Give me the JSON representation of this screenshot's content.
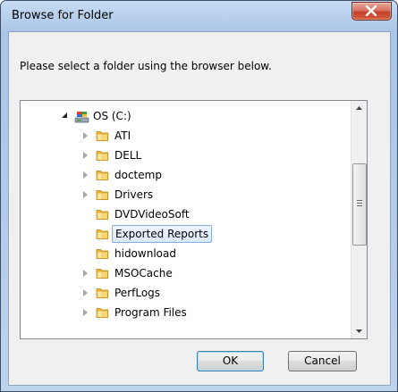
{
  "window": {
    "title": "Browse for Folder",
    "close_label": "X"
  },
  "dialog": {
    "prompt": "Please select a folder using the browser below.",
    "ok_label": "OK",
    "cancel_label": "Cancel"
  },
  "tree": {
    "items": [
      {
        "label": "OS (C:)",
        "expander": "expanded",
        "icon": "drive-icon",
        "level": 0
      },
      {
        "label": "ATI",
        "expander": "collapsed",
        "icon": "folder-icon",
        "level": 1
      },
      {
        "label": "DELL",
        "expander": "collapsed",
        "icon": "folder-icon",
        "level": 1
      },
      {
        "label": "doctemp",
        "expander": "collapsed",
        "icon": "folder-icon",
        "level": 1
      },
      {
        "label": "Drivers",
        "expander": "collapsed",
        "icon": "folder-icon",
        "level": 1
      },
      {
        "label": "DVDVideoSoft",
        "expander": "none",
        "icon": "folder-icon",
        "level": 1
      },
      {
        "label": "Exported Reports",
        "expander": "none",
        "icon": "folder-icon",
        "level": 1,
        "selected": true
      },
      {
        "label": "hidownload",
        "expander": "none",
        "icon": "folder-icon",
        "level": 1
      },
      {
        "label": "MSOCache",
        "expander": "collapsed",
        "icon": "folder-icon",
        "level": 1
      },
      {
        "label": "PerfLogs",
        "expander": "collapsed",
        "icon": "folder-icon",
        "level": 1
      },
      {
        "label": "Program Files",
        "expander": "collapsed",
        "icon": "folder-icon",
        "level": 1
      }
    ]
  },
  "colors": {
    "title_bar": "#b8d0ec",
    "close_button": "#c2412a",
    "selection_border": "#84acdd",
    "folder_yellow": "#f3c754"
  }
}
